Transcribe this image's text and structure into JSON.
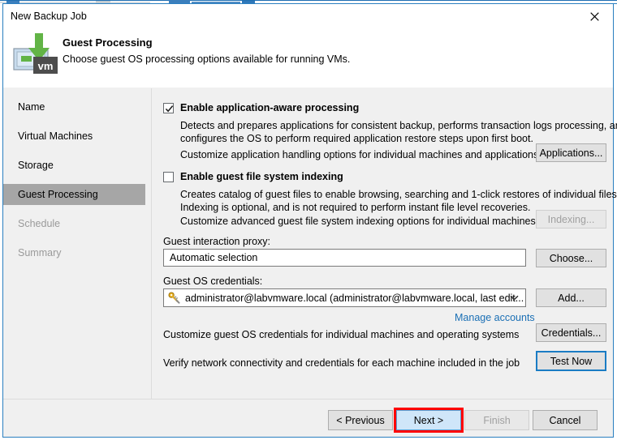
{
  "window": {
    "title": "New Backup Job",
    "close_icon": "close-icon"
  },
  "header": {
    "icon": "vm-backup-icon",
    "title": "Guest Processing",
    "subtitle": "Choose guest OS processing options available for running VMs."
  },
  "sidebar": {
    "items": [
      {
        "label": "Name",
        "state": "normal"
      },
      {
        "label": "Virtual Machines",
        "state": "normal"
      },
      {
        "label": "Storage",
        "state": "normal"
      },
      {
        "label": "Guest Processing",
        "state": "selected"
      },
      {
        "label": "Schedule",
        "state": "disabled"
      },
      {
        "label": "Summary",
        "state": "disabled"
      }
    ]
  },
  "content": {
    "app_aware": {
      "checkbox_label": "Enable application-aware processing",
      "checked": true,
      "desc_line1": "Detects and prepares applications for consistent backup, performs transaction logs processing, and",
      "desc_line2": "configures the OS to perform required application restore steps upon first boot.",
      "customize_text": "Customize application handling options for individual machines and applications",
      "button_label": "Applications...",
      "button_state": "enabled"
    },
    "indexing": {
      "checkbox_label": "Enable guest file system indexing",
      "checked": false,
      "desc_line1": "Creates catalog of guest files to enable browsing, searching and 1-click restores of individual files.",
      "desc_line2": "Indexing is optional, and is not required to perform instant file level recoveries.",
      "customize_text": "Customize advanced guest file system indexing options for individual machines",
      "button_label": "Indexing...",
      "button_state": "disabled"
    },
    "proxy": {
      "label": "Guest interaction proxy:",
      "value": "Automatic selection",
      "button_label": "Choose..."
    },
    "credentials": {
      "label": "Guest OS credentials:",
      "value": "administrator@labvmware.local (administrator@labvmware.local, last edit...",
      "icon": "key-icon",
      "dropdown_icon": "chevron-down-icon",
      "button_label": "Add...",
      "manage_link": "Manage accounts"
    },
    "customize_creds": {
      "text": "Customize guest OS credentials for individual machines and operating systems",
      "button_label": "Credentials..."
    },
    "test": {
      "text": "Verify network connectivity and credentials for each machine included in the job",
      "button_label": "Test Now"
    }
  },
  "footer": {
    "previous_label": "< Previous",
    "next_label": "Next >",
    "finish_label": "Finish",
    "cancel_label": "Cancel",
    "finish_state": "disabled",
    "next_highlighted": true
  },
  "colors": {
    "window_border": "#2a7fc0",
    "dialog_bg": "#f0f0f0",
    "selected_nav": "#a6a6a6",
    "link": "#1a6fb5",
    "annotation": "#ff0000",
    "default_button": "#cfe6f9",
    "focus_border": "#1a7cc4",
    "arrow_green": "#62b446",
    "key_gold": "#e8b020"
  }
}
